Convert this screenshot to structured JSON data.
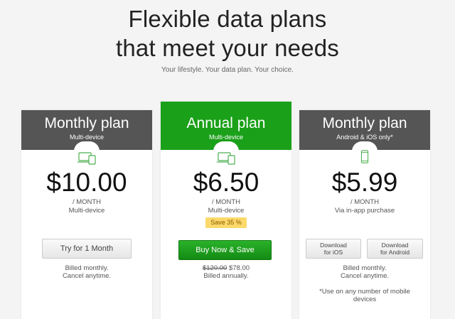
{
  "hero": {
    "title_line1": "Flexible data plans",
    "title_line2": "that meet your needs",
    "subtitle": "Your lifestyle. Your data plan. Your choice."
  },
  "plans": [
    {
      "title": "Monthly plan",
      "subtitle": "Multi-device",
      "icon": "multi-device-icon",
      "price": "$10.00",
      "per": "/ MONTH",
      "detail": "Multi-device",
      "button_label": "Try for 1 Month",
      "note_line1": "Billed monthly.",
      "note_line2": "Cancel anytime."
    },
    {
      "title": "Annual plan",
      "subtitle": "Multi-device",
      "icon": "multi-device-icon",
      "price": "$6.50",
      "per": "/ MONTH",
      "detail": "Multi-device",
      "badge": "Save 35 %",
      "button_label": "Buy Now & Save",
      "old_price": "$120.00",
      "new_price": "$78.00",
      "note_line2": "Billed annually.",
      "accent_color": "#1aa019"
    },
    {
      "title": "Monthly plan",
      "subtitle": "Android & iOS only*",
      "icon": "phone-icon",
      "price": "$5.99",
      "per": "/ MONTH",
      "detail": "Via in-app purchase",
      "button_ios_line1": "Download",
      "button_ios_line2": "for iOS",
      "button_android_line1": "Download",
      "button_android_line2": "for Android",
      "note_line1": "Billed monthly.",
      "note_line2": "Cancel anytime.",
      "footnote_line1": "*Use on any number of mobile",
      "footnote_line2": "devices"
    }
  ]
}
